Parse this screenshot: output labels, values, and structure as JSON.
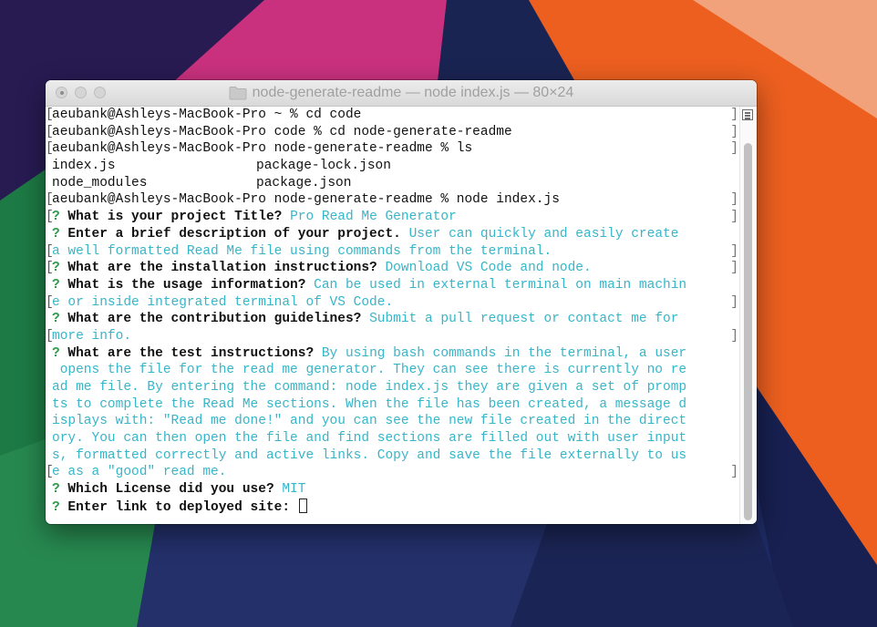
{
  "window": {
    "title": "node-generate-readme — node index.js — 80×24",
    "icons": [
      "close-button",
      "minimize-button",
      "zoom-button",
      "folder-icon"
    ]
  },
  "colors": {
    "answer": "#37b5c9",
    "prompt_mark": "#2c9c49",
    "text": "#111111"
  },
  "terminal": {
    "commands": {
      "c1": "aeubank@Ashleys-MacBook-Pro ~ % cd code",
      "c2": "aeubank@Ashleys-MacBook-Pro code % cd node-generate-readme",
      "c3": "aeubank@Ashleys-MacBook-Pro node-generate-readme % ls",
      "c4": "aeubank@Ashleys-MacBook-Pro node-generate-readme % node index.js"
    },
    "ls": {
      "a1": "index.js",
      "a2": "package-lock.json",
      "b1": "node_modules",
      "b2": "package.json"
    },
    "mark": "?",
    "qa": {
      "q1": "What is your project Title?",
      "a1": "Pro Read Me Generator",
      "q2": "Enter a brief description of your project.",
      "a2l1": "User can quickly and easily create",
      "a2l2": "a well formatted Read Me file using commands from the terminal.",
      "q3": "What are the installation instructions?",
      "a3": "Download VS Code and node.",
      "q4": "What is the usage information?",
      "a4l1": "Can be used in external terminal on main machin",
      "a4l2": "e or inside integrated terminal of VS Code.",
      "q5": "What are the contribution guidelines?",
      "a5l1": "Submit a pull request or contact me for",
      "a5l2": "more info.",
      "q6": "What are the test instructions?",
      "a6l1": "By using bash commands in the terminal, a user",
      "a6l2": " opens the file for the read me generator. They can see there is currently no re",
      "a6l3": "ad me file. By entering the command: node index.js they are given a set of promp",
      "a6l4": "ts to complete the Read Me sections. When the file has been created, a message d",
      "a6l5": "isplays with: \"Read me done!\" and you can see the new file created in the direct",
      "a6l6": "ory. You can then open the file and find sections are filled out with user input",
      "a6l7": "s, formatted correctly and active links. Copy and save the file externally to us",
      "a6l8": "e as a \"good\" read me.",
      "q7": "Which License did you use?",
      "a7": "MIT",
      "q8": "Enter link to deployed site:"
    }
  }
}
